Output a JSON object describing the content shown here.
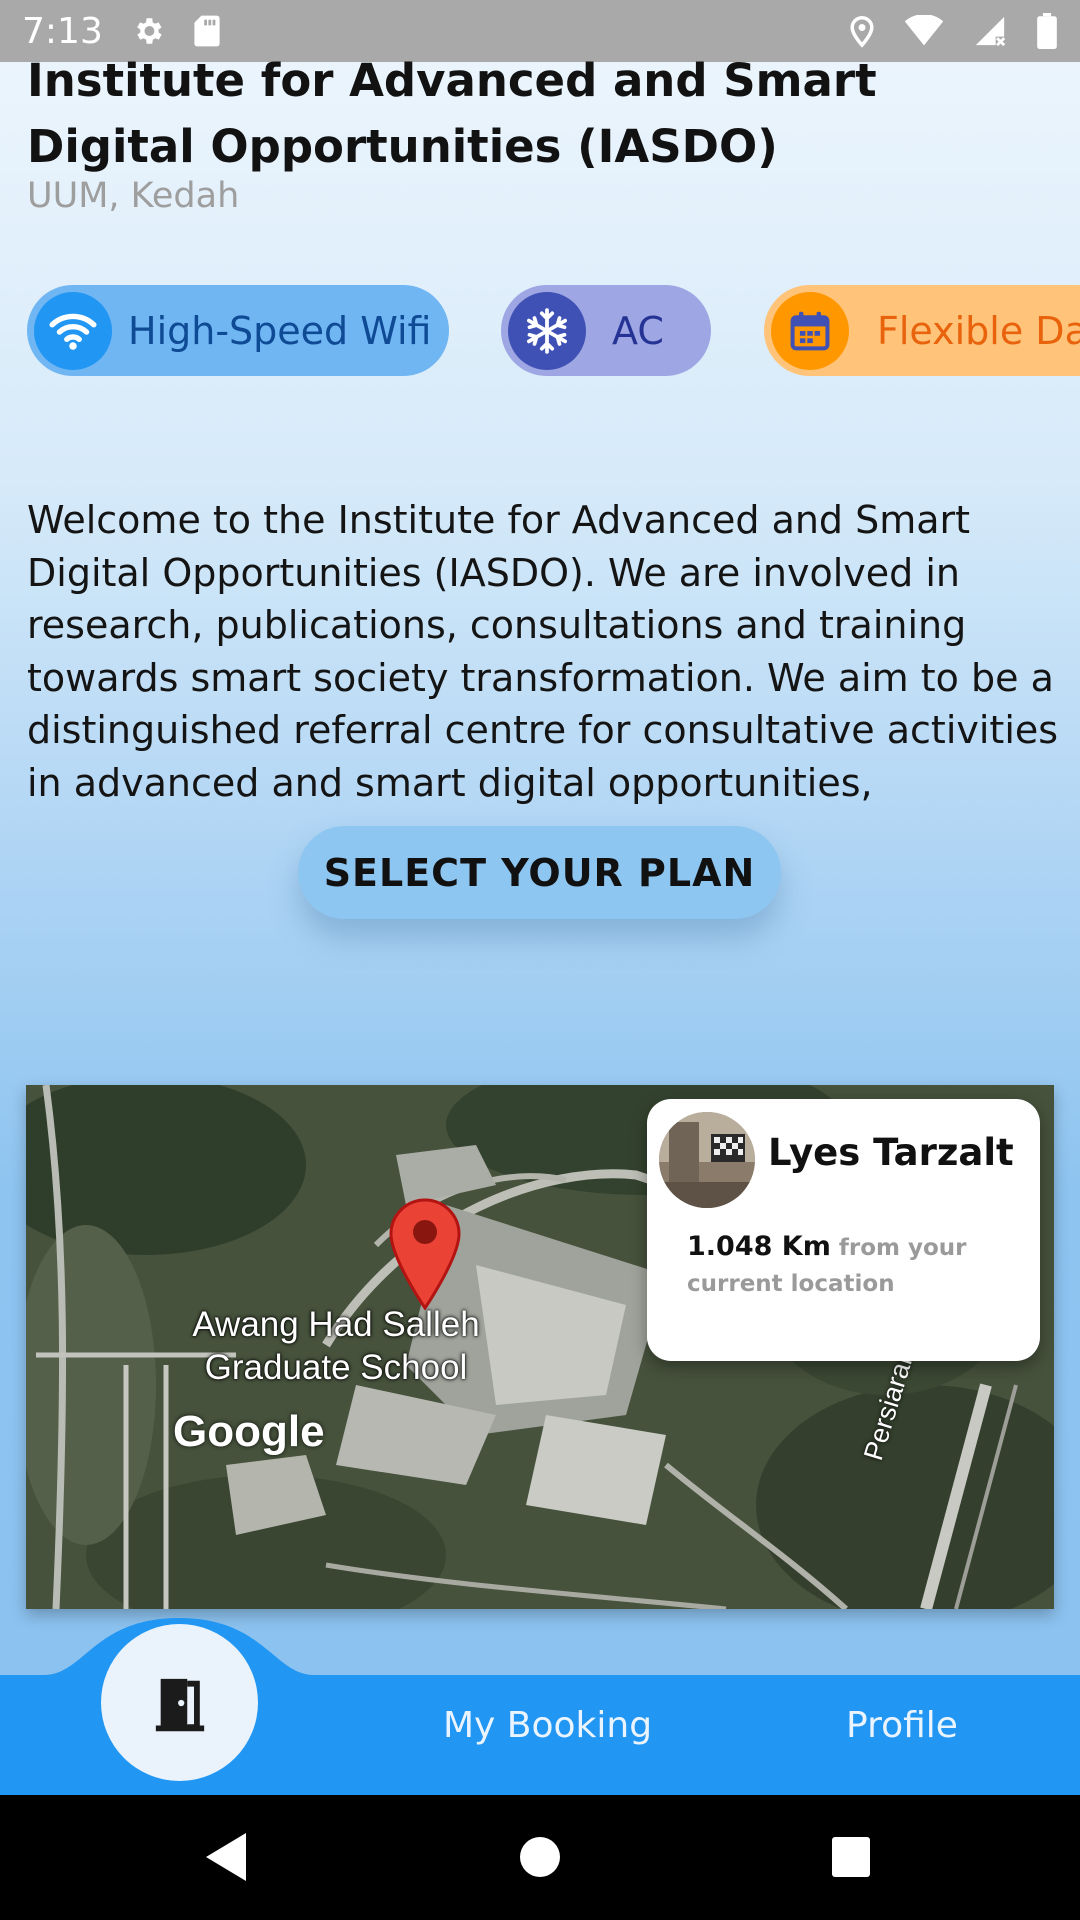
{
  "status_bar": {
    "time": "7:13"
  },
  "place": {
    "title": "Institute for Advanced and Smart Digital Opportunities (IASDO)",
    "location": "UUM, Kedah"
  },
  "amenities": [
    {
      "label": "High-Speed Wifi",
      "icon": "wifi-icon",
      "color": "#2196f3"
    },
    {
      "label": "AC",
      "icon": "snowflake-icon",
      "color": "#3f51b5"
    },
    {
      "label": "Flexible Date",
      "icon": "calendar-icon",
      "color": "#ff9800"
    }
  ],
  "description": "Welcome to the Institute for Advanced and Smart Digital Opportunities (IASDO).  We are involved in research, publications, consultations and training towards smart society transformation. We aim to be a distinguished referral centre for consultative activities in advanced and smart digital opportunities,",
  "cta": {
    "label": "SELECT YOUR PLAN"
  },
  "map": {
    "place_label": "Awang Had Salleh Graduate School",
    "attribution": "Google",
    "road_label": "Persiaran Perdana"
  },
  "host_card": {
    "name": "Lyes Tarzalt",
    "distance": "1.048 Km",
    "distance_suffix": "from your current location"
  },
  "bottom_nav": {
    "home_icon": "door-icon",
    "items": [
      {
        "label": "My Booking"
      },
      {
        "label": "Profile"
      }
    ]
  },
  "colors": {
    "accent": "#2196f3",
    "pin": "#ea4335"
  }
}
